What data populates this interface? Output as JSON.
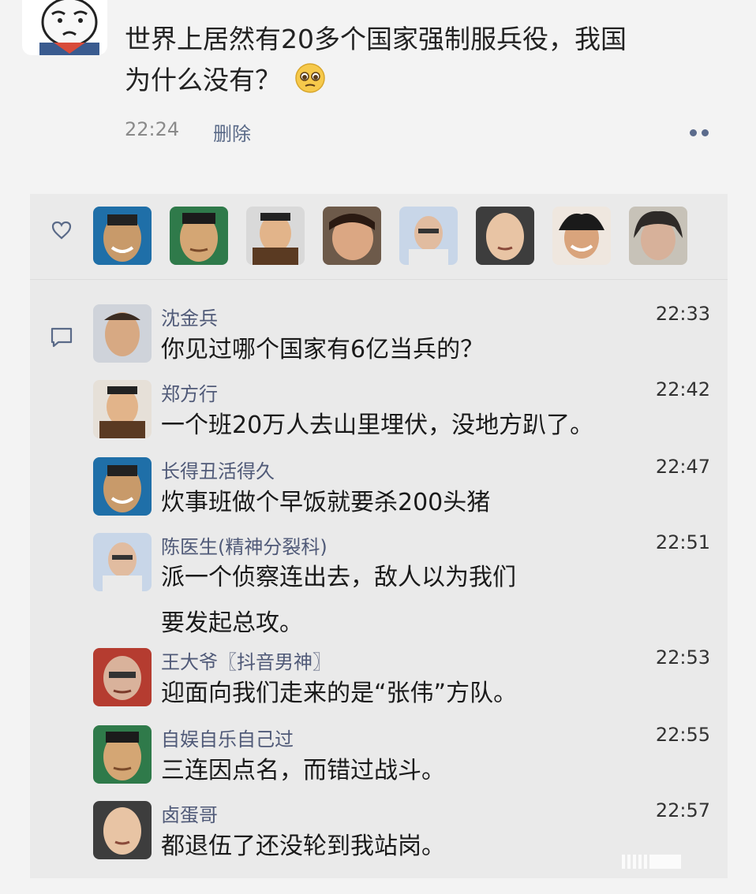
{
  "post": {
    "text": "世界上居然有20多个国家强制服兵役，我国为什么没有？",
    "time": "22:24",
    "delete_label": "删除"
  },
  "likes": {
    "avatar_icons": [
      "avatar-1",
      "avatar-2",
      "avatar-3",
      "avatar-4",
      "avatar-5",
      "avatar-6",
      "avatar-7",
      "avatar-8"
    ]
  },
  "comments": [
    {
      "name": "沈金兵",
      "time": "22:33",
      "text": "你见过哪个国家有6亿当兵的？"
    },
    {
      "name": "郑方行",
      "time": "22:42",
      "text": "一个班20万人去山里埋伏，没地方趴了。"
    },
    {
      "name": "长得丑活得久",
      "time": "22:47",
      "text": "炊事班做个早饭就要杀200头猪"
    },
    {
      "name": "陈医生(精神分裂科)",
      "time": "22:51",
      "text": "派一个侦察连出去，敌人以为我们要发起总攻。"
    },
    {
      "name": "王大爷〖抖音男神〗",
      "time": "22:53",
      "text": "迎面向我们走来的是“张伟”方队。"
    },
    {
      "name": "自娱自乐自己过",
      "time": "22:55",
      "text": "三连因点名，而错过战斗。"
    },
    {
      "name": "卤蛋哥",
      "time": "22:57",
      "text": "都退伍了还没轮到我站岗。"
    }
  ],
  "colors": {
    "name": "#505a78",
    "background": "#f3f3f3",
    "interaction_box": "#eaeaea"
  }
}
